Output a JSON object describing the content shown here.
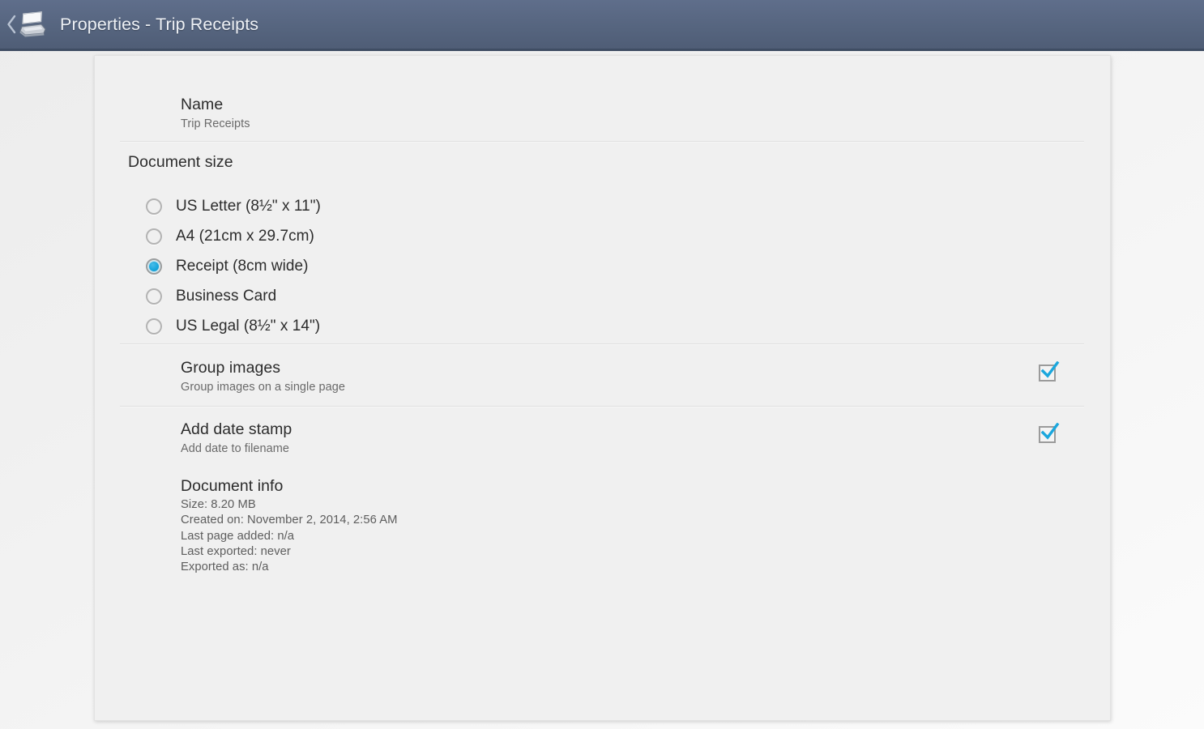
{
  "titlebar": {
    "back_icon": "back-chevron-icon",
    "app_icon": "scanner-icon",
    "title": "Properties - Trip Receipts",
    "background_color": "#56657f",
    "text_color": "#eef1f5"
  },
  "name_pref": {
    "title": "Name",
    "value": "Trip Receipts"
  },
  "document_size": {
    "header": "Document size",
    "selected_index": 2,
    "options": [
      {
        "label": "US Letter (8½\" x 11\")",
        "checked": false
      },
      {
        "label": "A4 (21cm x 29.7cm)",
        "checked": false
      },
      {
        "label": "Receipt (8cm wide)",
        "checked": true
      },
      {
        "label": "Business Card",
        "checked": false
      },
      {
        "label": "US Legal (8½\" x 14\")",
        "checked": false
      }
    ]
  },
  "group_images": {
    "title": "Group images",
    "subtitle": "Group images on a single page",
    "checked": true
  },
  "add_date_stamp": {
    "title": "Add date stamp",
    "subtitle": "Add date to filename",
    "checked": true
  },
  "document_info": {
    "title": "Document info",
    "lines": [
      "Size: 8.20 MB",
      "Created on: November 2, 2014, 2:56 AM",
      "Last page added: n/a",
      "Last exported: never",
      "Exported as: n/a"
    ]
  },
  "colors": {
    "accent": "#1ba7dd",
    "titlebar": "#56657f",
    "card_bg": "#f0f0f0",
    "divider": "#e0e0e0"
  }
}
